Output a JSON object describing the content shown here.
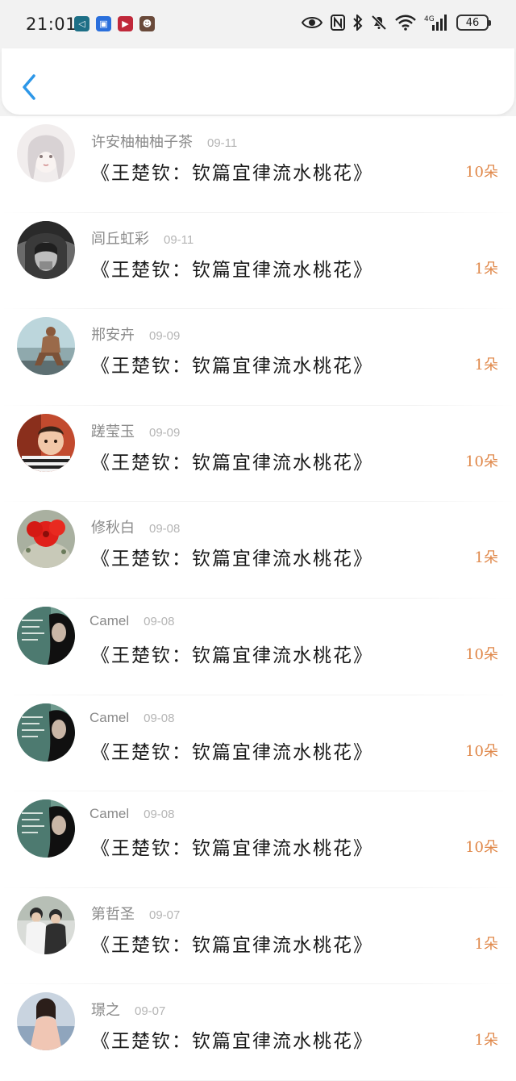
{
  "status_bar": {
    "time": "21:01",
    "battery": "46",
    "network": "4G",
    "colors": {
      "notif_1": "#1d6f86",
      "notif_2": "#2a6fdc",
      "notif_3": "#c0283a",
      "notif_4": "#6a4a3a"
    }
  },
  "header": {
    "back_icon": "chevron-left-icon",
    "accent": "#2d97e8"
  },
  "list": [
    {
      "name": "许安柚柚柚子茶",
      "date": "09-11",
      "title": "《王楚钦：钦篇宜律流水桃花》",
      "count": "10朵"
    },
    {
      "name": "闾丘虹彩",
      "date": "09-11",
      "title": "《王楚钦：钦篇宜律流水桃花》",
      "count": "1朵"
    },
    {
      "name": "郱安卉",
      "date": "09-09",
      "title": "《王楚钦：钦篇宜律流水桃花》",
      "count": "1朵"
    },
    {
      "name": "蹉莹玉",
      "date": "09-09",
      "title": "《王楚钦：钦篇宜律流水桃花》",
      "count": "10朵"
    },
    {
      "name": "修秋白",
      "date": "09-08",
      "title": "《王楚钦：钦篇宜律流水桃花》",
      "count": "1朵"
    },
    {
      "name": "Camel",
      "date": "09-08",
      "title": "《王楚钦：钦篇宜律流水桃花》",
      "count": "10朵"
    },
    {
      "name": "Camel",
      "date": "09-08",
      "title": "《王楚钦：钦篇宜律流水桃花》",
      "count": "10朵"
    },
    {
      "name": "Camel",
      "date": "09-08",
      "title": "《王楚钦：钦篇宜律流水桃花》",
      "count": "10朵"
    },
    {
      "name": "第哲圣",
      "date": "09-07",
      "title": "《王楚钦：钦篇宜律流水桃花》",
      "count": "1朵"
    },
    {
      "name": "璟之",
      "date": "09-07",
      "title": "《王楚钦：钦篇宜律流水桃花》",
      "count": "1朵"
    }
  ],
  "colors": {
    "count_text": "#e0884a",
    "name_text": "#8a8a8a",
    "date_text": "#b5b5b5",
    "title_text": "#1a1a1a"
  }
}
